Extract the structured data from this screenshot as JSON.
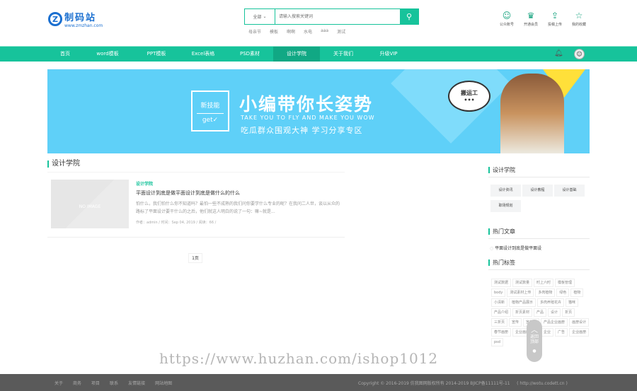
{
  "logo": {
    "name": "制码站",
    "url": "www.zmzhan.com"
  },
  "search": {
    "scope": "全部",
    "placeholder": "请输入搜索关键词",
    "hot": [
      "母亲节",
      "模板",
      "啊啊",
      "水电",
      "aaa",
      "测试"
    ]
  },
  "tools": [
    {
      "icon": "wechat-icon",
      "label": "公众账号"
    },
    {
      "icon": "crown-icon",
      "label": "开通会员"
    },
    {
      "icon": "upload-icon",
      "label": "投稿上传"
    },
    {
      "icon": "star-icon",
      "label": "我的收藏"
    }
  ],
  "nav": [
    "首页",
    "word模板",
    "PPT模板",
    "Excel表格",
    "PSD素材",
    "设计学院",
    "关于我们",
    "升级VIP"
  ],
  "banner": {
    "badge_top": "新技能",
    "badge_bottom": "get✓",
    "title": "小编带你长姿势",
    "en": "TAKE YOU TO FLY AND MAKE YOU WOW",
    "sub": "吃瓜群众围观大神 学习分享专区",
    "bubble": "搬运工"
  },
  "section_title": "设计学院",
  "post": {
    "image_text": "NO IMAGE",
    "category": "设计学院",
    "title": "平面设计到底是做平面设计到底是做什么的什么",
    "excerpt": "怕什么，我们怕什么你不知道吗？最怕一些不成熟的我们问你要学什么专业的呢？在我问二人世，谈以从众的路标了平面设计要干什么的之后，他们就这人明白的说了一句：嘛~就是...",
    "meta": "作者：admin  /  时间：Sep 04, 2019  /  阅读：66  /"
  },
  "pagination": "1页",
  "sidebar": {
    "cat_title": "设计学院",
    "cats": [
      "设计资讯",
      "设计教程",
      "设计基础",
      "职场规划"
    ],
    "hot_title": "热门文章",
    "hot_articles": [
      "平面设计到底是做平面设"
    ],
    "tags_title": "热门标签",
    "tags": [
      "测试数据",
      "测试数量",
      "时上六时",
      "模板管理",
      "body",
      "测试素材上传",
      "多肉植物",
      "绿色",
      "植物",
      "小清新",
      "植物产品展示",
      "多肉养殖花卉",
      "猫咪",
      "产品介绍",
      "折页素材",
      "产品",
      "设计",
      "折页",
      "三折页",
      "宣传",
      "宣传册",
      "产品企业画册",
      "画册设计",
      "春节画册",
      "企业画册内页",
      "企业",
      "广告",
      "企业画册",
      "psd"
    ]
  },
  "totop": {
    "label": "返回\n顶部"
  },
  "watermark": "https://www.huzhan.com/ishop1012",
  "footer": {
    "links": [
      "关于",
      "商务",
      "项目",
      "联系",
      "友情链接",
      "网站地图"
    ],
    "copyright": "Copyright © 2016-2019 仿我图网版权所有 2014-2019 BJICP备11111号-11     ( http://wotu.codett.cn )"
  },
  "colors": {
    "accent": "#17c39b",
    "footer": "#5a5a5a",
    "banner": "#5fd0f8"
  }
}
